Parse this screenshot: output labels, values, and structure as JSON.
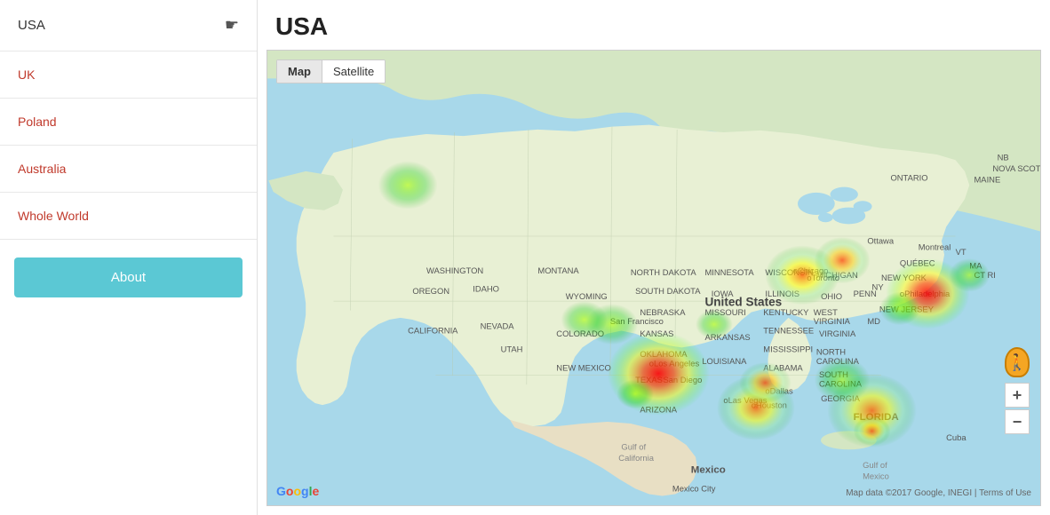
{
  "sidebar": {
    "items": [
      {
        "id": "usa",
        "label": "USA",
        "active": true,
        "style": "active"
      },
      {
        "id": "uk",
        "label": "UK",
        "style": "link"
      },
      {
        "id": "poland",
        "label": "Poland",
        "style": "link"
      },
      {
        "id": "australia",
        "label": "Australia",
        "style": "link"
      },
      {
        "id": "whole-world",
        "label": "Whole World",
        "style": "link"
      }
    ],
    "about_button": "About"
  },
  "main": {
    "title": "USA",
    "map": {
      "controls": [
        {
          "id": "map",
          "label": "Map",
          "active": true
        },
        {
          "id": "satellite",
          "label": "Satellite",
          "active": false
        }
      ],
      "attribution": "Map data ©2017 Google, INEGI  |  Terms of Use",
      "zoom_in": "+",
      "zoom_out": "−"
    }
  }
}
